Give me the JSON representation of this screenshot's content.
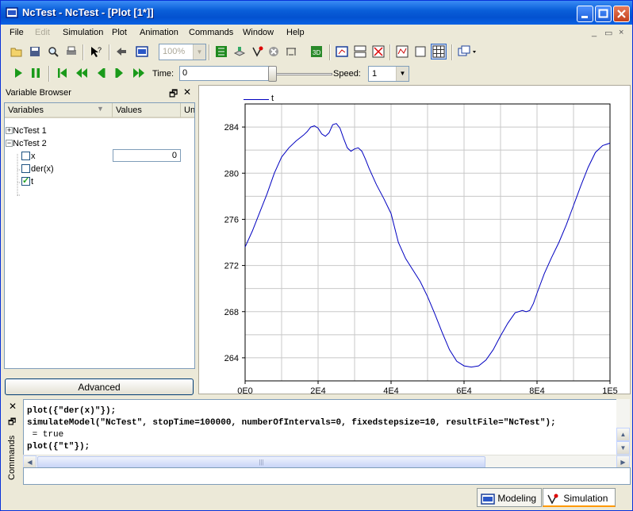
{
  "window": {
    "title": "NcTest - NcTest  - [Plot [1*]]"
  },
  "menu": [
    {
      "label": "File",
      "enabled": true
    },
    {
      "label": "Edit",
      "enabled": false
    },
    {
      "label": "Simulation",
      "enabled": true
    },
    {
      "label": "Plot",
      "enabled": true
    },
    {
      "label": "Animation",
      "enabled": true
    },
    {
      "label": "Commands",
      "enabled": true
    },
    {
      "label": "Window",
      "enabled": true
    },
    {
      "label": "Help",
      "enabled": true
    }
  ],
  "mdi_controls": [
    "×",
    "🗗",
    "×"
  ],
  "toolbar": {
    "zoom": "100%",
    "time_label": "Time:",
    "time_value": "0",
    "speed_label": "Speed:",
    "speed_value": "1"
  },
  "variable_browser": {
    "title": "Variable Browser",
    "columns": [
      "Variables",
      "Values",
      "Un"
    ],
    "nodes": [
      {
        "label": "NcTest 1",
        "expander": "+"
      },
      {
        "label": "NcTest 2",
        "expander": "−"
      }
    ],
    "variables": [
      {
        "label": "x",
        "checked": false,
        "value": "0"
      },
      {
        "label": "der(x)",
        "checked": false,
        "value": ""
      },
      {
        "label": "t",
        "checked": true,
        "value": ""
      }
    ],
    "advanced_label": "Advanced"
  },
  "chart_data": {
    "type": "line",
    "series": [
      {
        "name": "t",
        "color": "#0000c0",
        "x": [
          0,
          2000,
          4000,
          6000,
          8000,
          10000,
          12000,
          14000,
          16000,
          17000,
          18000,
          19000,
          20000,
          21000,
          22000,
          23000,
          24000,
          25000,
          26000,
          27000,
          28000,
          29000,
          30000,
          31000,
          32000,
          33000,
          34000,
          36000,
          38000,
          40000,
          42000,
          44000,
          46000,
          48000,
          50000,
          52000,
          54000,
          56000,
          58000,
          60000,
          62000,
          64000,
          66000,
          68000,
          70000,
          72000,
          74000,
          76000,
          77000,
          78000,
          79000,
          80000,
          82000,
          84000,
          86000,
          88000,
          90000,
          92000,
          94000,
          96000,
          98000,
          100000
        ],
        "y": [
          273.6,
          275.0,
          276.6,
          278.2,
          280.0,
          281.4,
          282.2,
          282.8,
          283.3,
          283.6,
          284.0,
          284.1,
          283.9,
          283.4,
          283.2,
          283.5,
          284.2,
          284.3,
          283.9,
          283.0,
          282.2,
          281.9,
          282.1,
          282.2,
          281.9,
          281.2,
          280.4,
          279.0,
          277.8,
          276.5,
          274.0,
          272.6,
          271.6,
          270.6,
          269.3,
          267.8,
          266.2,
          264.7,
          263.7,
          263.3,
          263.2,
          263.3,
          263.8,
          264.7,
          265.9,
          267.0,
          267.9,
          268.1,
          268.0,
          268.1,
          268.7,
          269.6,
          271.3,
          272.7,
          274.0,
          275.5,
          277.2,
          278.9,
          280.5,
          281.8,
          282.4,
          282.6
        ]
      }
    ],
    "xlim": [
      0,
      100000
    ],
    "ylim": [
      262,
      286
    ],
    "x_ticks": [
      {
        "v": 0,
        "label": "0E0"
      },
      {
        "v": 20000,
        "label": "2E4"
      },
      {
        "v": 40000,
        "label": "4E4"
      },
      {
        "v": 60000,
        "label": "6E4"
      },
      {
        "v": 80000,
        "label": "8E4"
      },
      {
        "v": 100000,
        "label": "1E5"
      }
    ],
    "y_ticks": [
      {
        "v": 264,
        "label": "264"
      },
      {
        "v": 268,
        "label": "268"
      },
      {
        "v": 272,
        "label": "272"
      },
      {
        "v": 276,
        "label": "276"
      },
      {
        "v": 280,
        "label": "280"
      },
      {
        "v": 284,
        "label": "284"
      }
    ],
    "grid": true,
    "legend": "top-left"
  },
  "commands": {
    "side_label": "Commands",
    "lines": [
      {
        "text": "    ...",
        "bold": false
      },
      {
        "text": "plot({\"der(x)\"});",
        "bold": true
      },
      {
        "text": "simulateModel(\"NcTest\", stopTime=100000, numberOfIntervals=0, fixedstepsize=10, resultFile=\"NcTest\");",
        "bold": true
      },
      {
        "text": " = true",
        "bold": false
      },
      {
        "text": "plot({\"t\"});",
        "bold": true
      }
    ]
  },
  "status_tabs": [
    {
      "label": "Modeling",
      "active": false
    },
    {
      "label": "Simulation",
      "active": true
    }
  ]
}
